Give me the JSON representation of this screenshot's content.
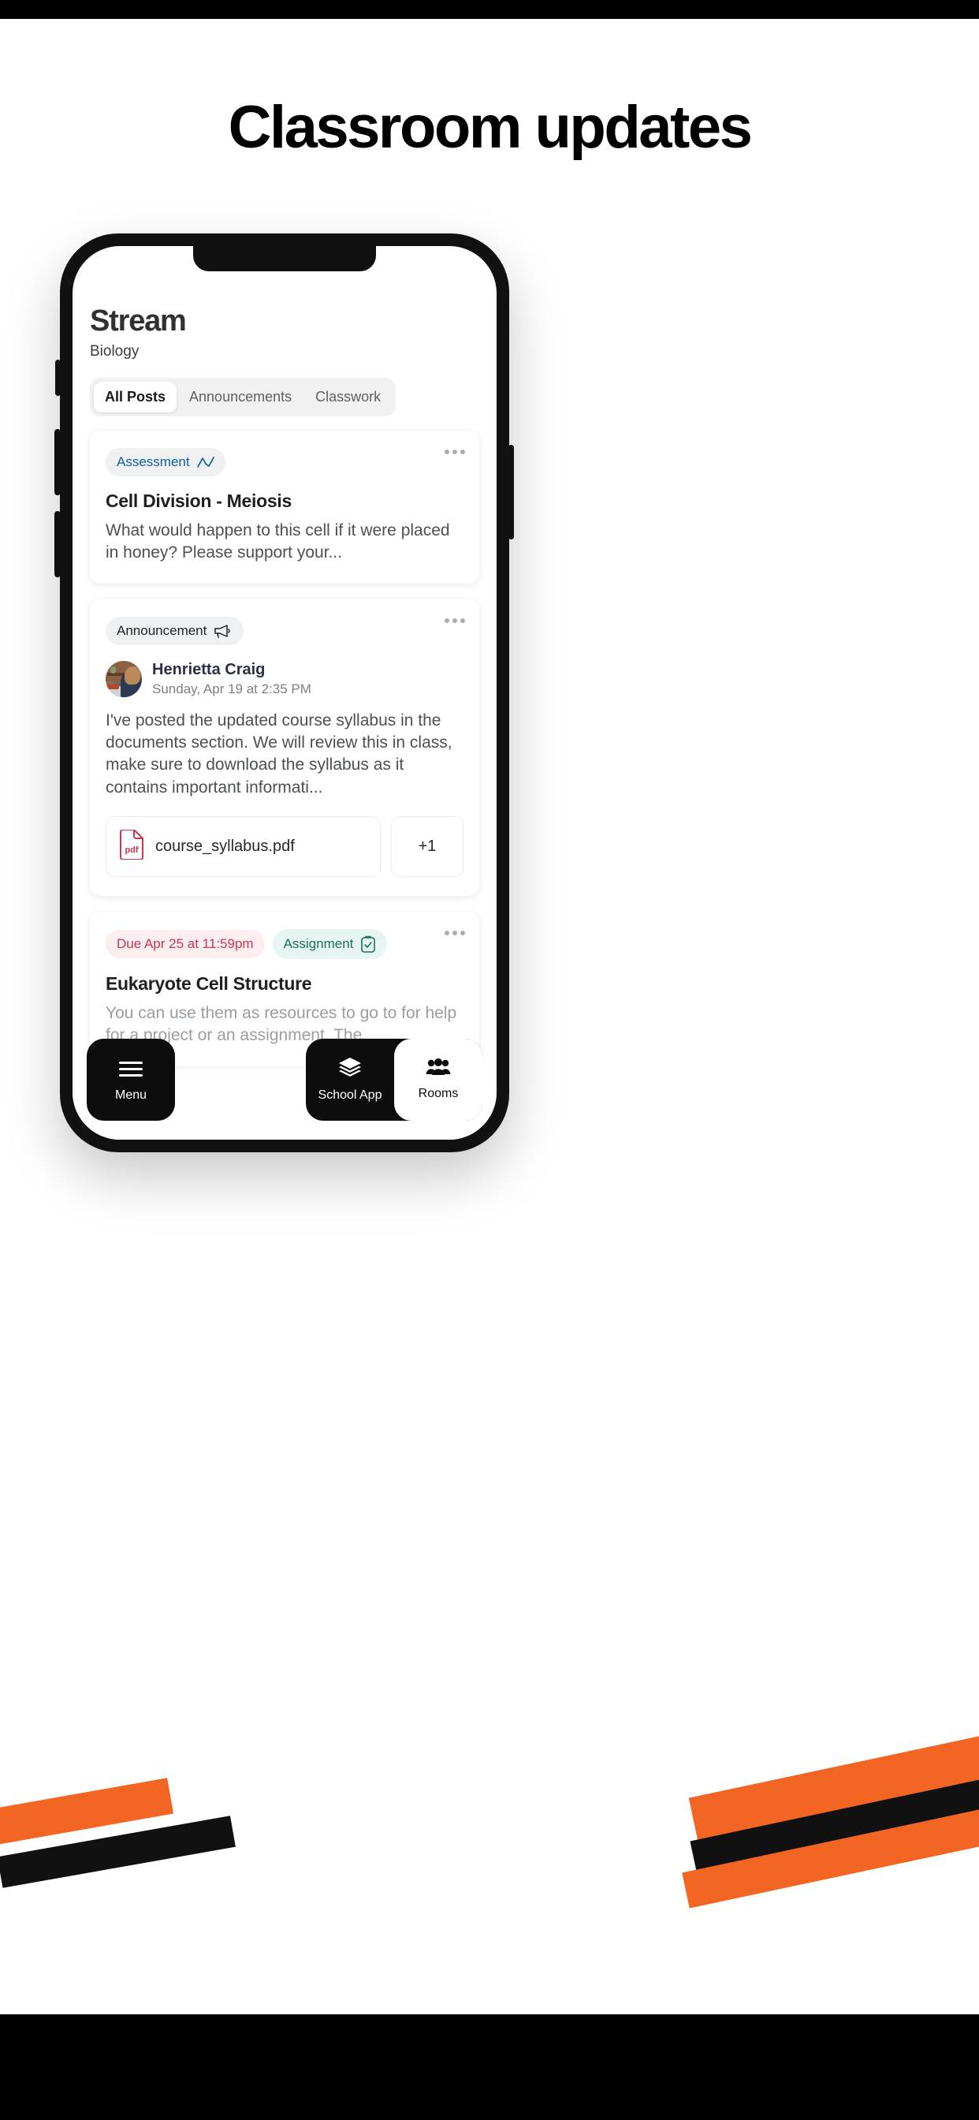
{
  "promo": {
    "headline": "Classroom updates"
  },
  "app": {
    "title": "Stream",
    "subtitle": "Biology",
    "tabs": [
      {
        "label": "All Posts",
        "active": true
      },
      {
        "label": "Announcements",
        "active": false
      },
      {
        "label": "Classwork",
        "active": false
      }
    ],
    "posts": [
      {
        "badges": [
          {
            "label": "Assessment",
            "icon": "trend-chart-icon",
            "style": "blue"
          }
        ],
        "title": "Cell Division - Meiosis",
        "body": "What would happen to this cell if it were placed in honey? Please support your...",
        "overflow_menu": "more-options"
      },
      {
        "badges": [
          {
            "label": "Announcement",
            "icon": "megaphone-icon",
            "style": "plain"
          }
        ],
        "author": {
          "name": "Henrietta Craig",
          "timestamp": "Sunday, Apr 19 at 2:35 PM",
          "avatar": "author-photo"
        },
        "body": "I've posted the updated course syllabus in the documents section. We will review this in class, make sure to download the syllabus as it contains important informati...",
        "attachments": [
          {
            "name": "course_syllabus.pdf",
            "type": "pdf"
          }
        ],
        "attachment_more": "+1",
        "overflow_menu": "more-options"
      },
      {
        "badges": [
          {
            "label": "Due Apr 25 at 11:59pm",
            "icon": "",
            "style": "due"
          },
          {
            "label": "Assignment",
            "icon": "clipboard-check-icon",
            "style": "assign"
          }
        ],
        "title": "Eukaryote Cell Structure",
        "body": "You can use them as resources to go to for help for a project or an assignment. The",
        "overflow_menu": "more-options"
      }
    ],
    "bottom_nav": {
      "menu": {
        "label": "Menu",
        "icon": "hamburger-icon"
      },
      "items": [
        {
          "label": "School App",
          "icon": "layers-icon",
          "active": false
        },
        {
          "label": "Rooms",
          "icon": "people-icon",
          "active": true
        }
      ]
    }
  },
  "colors": {
    "accent_orange": "#f26522",
    "badge_blue": "#0f5d9e",
    "due_red": "#cf3552",
    "assign_green": "#1d6e5c",
    "pdf_red": "#cf3552"
  }
}
